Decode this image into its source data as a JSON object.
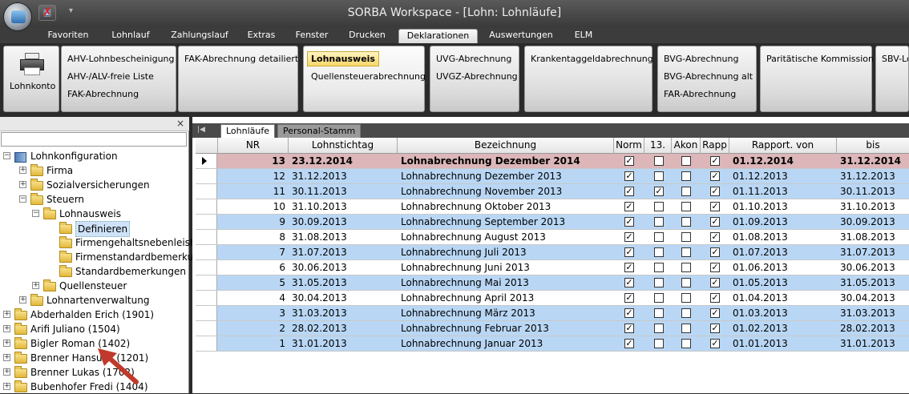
{
  "window": {
    "title": "SORBA Workspace - [Lohn: Lohnläufe]"
  },
  "quick_access": {
    "icon1": "save-icon",
    "icon2": "close-icon",
    "dropdown": "▾"
  },
  "tabs": [
    "Favoriten",
    "Lohnlauf",
    "Zahlungslauf",
    "Extras",
    "Fenster",
    "Drucken",
    "Deklarationen",
    "Auswertungen",
    "ELM"
  ],
  "active_tab": "Deklarationen",
  "ribbon": {
    "lohnkonto": "Lohnkonto",
    "g1": [
      "AHV-Lohnbescheinigung",
      "AHV-/ALV-freie Liste",
      "FAK-Abrechnung"
    ],
    "g2": [
      "FAK-Abrechnung detailiert"
    ],
    "g3": [
      "Lohnausweis",
      "Quellensteuerabrechnung"
    ],
    "g4": [
      "UVG-Abrechnung",
      "UVGZ-Abrechnung"
    ],
    "g5": [
      "Krankentaggeldabrechnung"
    ],
    "g6": [
      "BVG-Abrechnung",
      "BVG-Abrechnung alt",
      "FAR-Abrechnung"
    ],
    "g7": [
      "Paritätische Kommission"
    ],
    "g8": [
      "SBV-Lo"
    ]
  },
  "tree": {
    "close": "×",
    "items": [
      {
        "label": "Lohnkonfiguration",
        "exp": "−"
      },
      {
        "label": "Firma",
        "exp": "+"
      },
      {
        "label": "Sozialversicherungen",
        "exp": "+"
      },
      {
        "label": "Steuern",
        "exp": "−"
      },
      {
        "label": "Lohnausweis",
        "exp": "−"
      },
      {
        "label": "Definieren",
        "exp": ""
      },
      {
        "label": "Firmengehaltsnebenleistungen",
        "exp": ""
      },
      {
        "label": "Firmenstandardbemerkungen",
        "exp": ""
      },
      {
        "label": "Standardbemerkungen",
        "exp": ""
      },
      {
        "label": "Quellensteuer",
        "exp": "+"
      },
      {
        "label": "Lohnartenverwaltung",
        "exp": "+"
      },
      {
        "label": "Abderhalden Erich (1901)",
        "exp": "+"
      },
      {
        "label": "Arifi Juliano (1504)",
        "exp": "+"
      },
      {
        "label": "Bigler Roman (1402)",
        "exp": "+"
      },
      {
        "label": "Brenner Hansueli (1201)",
        "exp": "+"
      },
      {
        "label": "Brenner Lukas (1702)",
        "exp": "+"
      },
      {
        "label": "Bubenhofer Fredi (1404)",
        "exp": "+"
      }
    ]
  },
  "grid_tabs": [
    "Lohnläufe",
    "Personal-Stamm"
  ],
  "grid": {
    "headers": [
      "NR",
      "Lohnstichtag",
      "Bezeichnung",
      "Norm",
      "13.",
      "Akon",
      "Rapp",
      "Rapport. von",
      "bis"
    ],
    "rows": [
      {
        "nr": "13",
        "date": "23.12.2014",
        "desc": "Lohnabrechnung Dezember 2014",
        "norm": true,
        "m13": false,
        "akon": false,
        "rapp": true,
        "von": "01.12.2014",
        "bis": "31.12.2014",
        "style": "cur"
      },
      {
        "nr": "12",
        "date": "31.12.2013",
        "desc": "Lohnabrechnung Dezember 2013",
        "norm": true,
        "m13": false,
        "akon": false,
        "rapp": true,
        "von": "01.12.2013",
        "bis": "31.12.2013",
        "style": "blue"
      },
      {
        "nr": "11",
        "date": "30.11.2013",
        "desc": "Lohnabrechnung November 2013",
        "norm": true,
        "m13": true,
        "akon": false,
        "rapp": true,
        "von": "01.11.2013",
        "bis": "30.11.2013",
        "style": "blue"
      },
      {
        "nr": "10",
        "date": "31.10.2013",
        "desc": "Lohnabrechnung Oktober 2013",
        "norm": true,
        "m13": false,
        "akon": false,
        "rapp": true,
        "von": "01.10.2013",
        "bis": "31.10.2013",
        "style": "white"
      },
      {
        "nr": "9",
        "date": "30.09.2013",
        "desc": "Lohnabrechnung September 2013",
        "norm": true,
        "m13": false,
        "akon": false,
        "rapp": true,
        "von": "01.09.2013",
        "bis": "30.09.2013",
        "style": "blue"
      },
      {
        "nr": "8",
        "date": "31.08.2013",
        "desc": "Lohnabrechnung August 2013",
        "norm": true,
        "m13": false,
        "akon": false,
        "rapp": true,
        "von": "01.08.2013",
        "bis": "31.08.2013",
        "style": "white"
      },
      {
        "nr": "7",
        "date": "31.07.2013",
        "desc": "Lohnabrechnung Juli 2013",
        "norm": true,
        "m13": false,
        "akon": false,
        "rapp": true,
        "von": "01.07.2013",
        "bis": "31.07.2013",
        "style": "blue"
      },
      {
        "nr": "6",
        "date": "30.06.2013",
        "desc": "Lohnabrechnung Juni 2013",
        "norm": true,
        "m13": false,
        "akon": false,
        "rapp": true,
        "von": "01.06.2013",
        "bis": "30.06.2013",
        "style": "white"
      },
      {
        "nr": "5",
        "date": "31.05.2013",
        "desc": "Lohnabrechnung Mai 2013",
        "norm": true,
        "m13": false,
        "akon": false,
        "rapp": true,
        "von": "01.05.2013",
        "bis": "31.05.2013",
        "style": "blue"
      },
      {
        "nr": "4",
        "date": "30.04.2013",
        "desc": "Lohnabrechnung April 2013",
        "norm": true,
        "m13": false,
        "akon": false,
        "rapp": true,
        "von": "01.04.2013",
        "bis": "30.04.2013",
        "style": "white"
      },
      {
        "nr": "3",
        "date": "31.03.2013",
        "desc": "Lohnabrechnung März 2013",
        "norm": true,
        "m13": false,
        "akon": false,
        "rapp": true,
        "von": "01.03.2013",
        "bis": "31.03.2013",
        "style": "blue"
      },
      {
        "nr": "2",
        "date": "28.02.2013",
        "desc": "Lohnabrechnung Februar 2013",
        "norm": true,
        "m13": false,
        "akon": false,
        "rapp": true,
        "von": "01.02.2013",
        "bis": "28.02.2013",
        "style": "blue"
      },
      {
        "nr": "1",
        "date": "31.01.2013",
        "desc": "Lohnabrechnung Januar 2013",
        "norm": true,
        "m13": false,
        "akon": false,
        "rapp": true,
        "von": "01.01.2013",
        "bis": "31.01.2013",
        "style": "blue"
      }
    ]
  },
  "colors": {
    "row_blue": "#b9d7f5",
    "row_current": "#dcb6b9",
    "highlight": "#f7d86a"
  }
}
